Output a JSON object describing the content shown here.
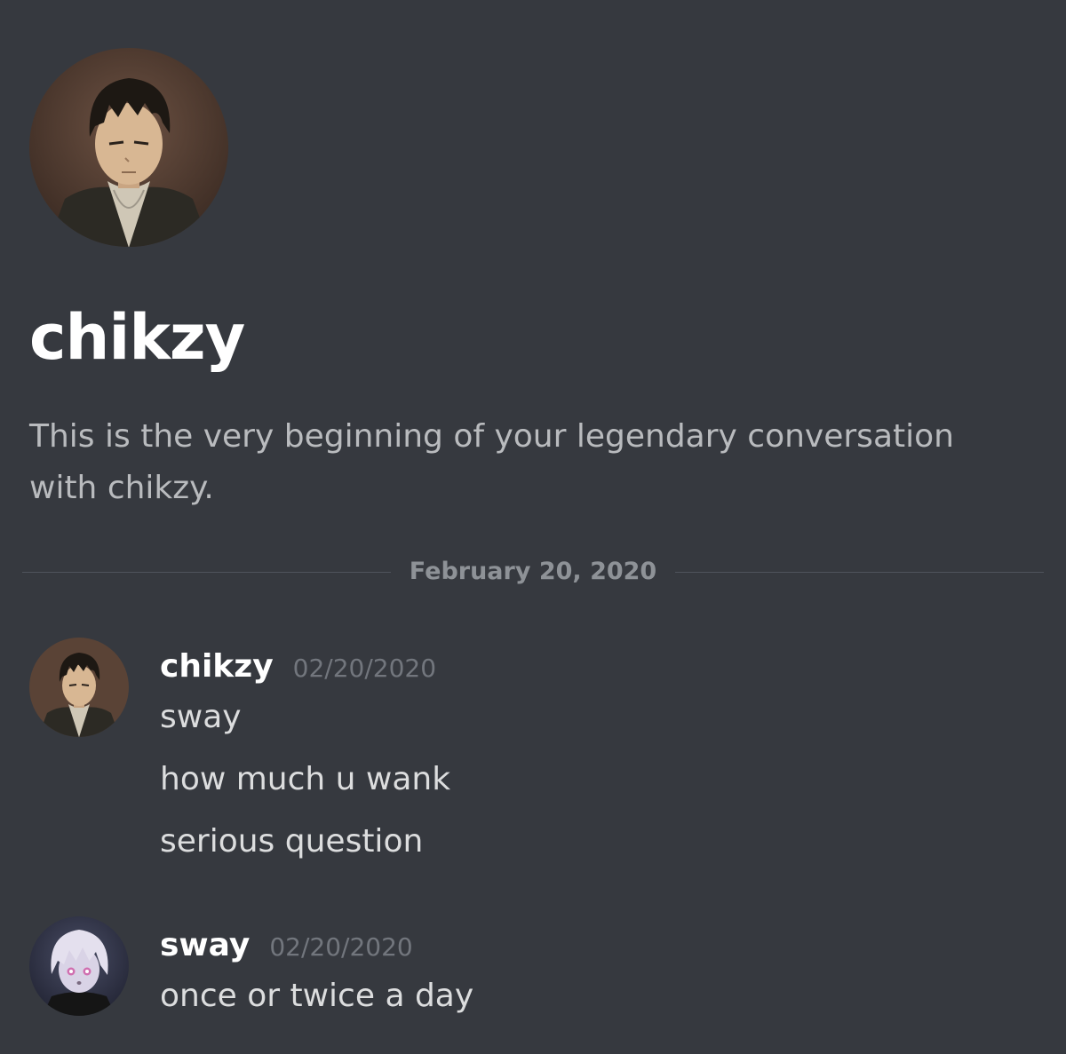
{
  "intro": {
    "title": "chikzy",
    "subtitle": "This is the very beginning of your legendary conversation with chikzy."
  },
  "divider": {
    "date": "February 20, 2020"
  },
  "messages": [
    {
      "author": "chikzy",
      "timestamp": "02/20/2020",
      "lines": [
        "sway",
        "how much u wank",
        "serious question"
      ]
    },
    {
      "author": "sway",
      "timestamp": "02/20/2020",
      "lines": [
        "once or twice a day"
      ]
    }
  ],
  "colors": {
    "background": "#36393f",
    "heading": "#ffffff",
    "body_text": "#dcddde",
    "muted_text": "#72767d",
    "divider_text": "#8e9297"
  }
}
